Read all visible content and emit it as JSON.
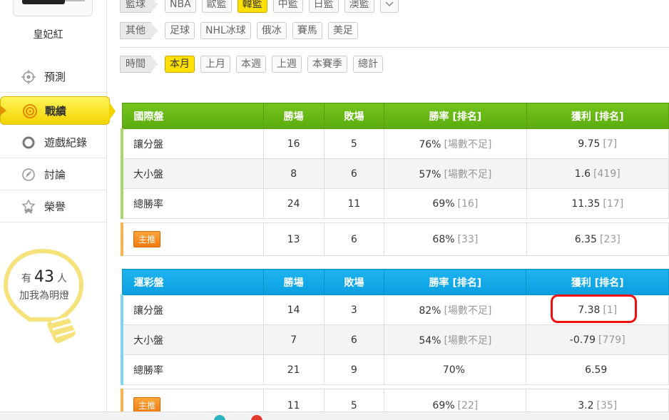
{
  "user": {
    "name": "皇妃紅"
  },
  "nav": [
    {
      "label": "預測",
      "icon": "target-icon"
    },
    {
      "label": "戰績",
      "icon": "swirl-icon",
      "active": true
    },
    {
      "label": "遊戲紀錄",
      "icon": "circle-icon"
    },
    {
      "label": "討論",
      "icon": "pencil-badge-icon"
    },
    {
      "label": "榮譽",
      "icon": "ribbon-icon"
    }
  ],
  "fans": {
    "prefix": "有",
    "count": "43",
    "suffix": "人",
    "subtitle": "加我為明燈"
  },
  "filters": {
    "basketball": {
      "label": "籃球",
      "options": [
        "NBA",
        "歐籃",
        "韓籃",
        "中籃",
        "日籃",
        "澳籃"
      ],
      "selected": "韓籃"
    },
    "others": {
      "label": "其他",
      "options": [
        "足球",
        "NHL冰球",
        "俄冰",
        "賽馬",
        "美足"
      ]
    },
    "time": {
      "label": "時間",
      "options": [
        "本月",
        "上月",
        "本週",
        "上週",
        "本賽季",
        "總計"
      ],
      "selected": "本月"
    }
  },
  "international": {
    "headers": [
      "國際盤",
      "勝場",
      "敗場",
      "勝率 [排名]",
      "獲利 [排名]"
    ],
    "rows": [
      {
        "name": "讓分盤",
        "win": "16",
        "loss": "5",
        "rate": "76%",
        "rate_rank": "[場數不足]",
        "profit": "9.75",
        "profit_rank": "[7]"
      },
      {
        "name": "大小盤",
        "win": "8",
        "loss": "6",
        "rate": "57%",
        "rate_rank": "[場數不足]",
        "profit": "1.6",
        "profit_rank": "[419]"
      },
      {
        "name": "總勝率",
        "win": "24",
        "loss": "11",
        "rate": "69%",
        "rate_rank": "[16]",
        "profit": "11.35",
        "profit_rank": "[17]"
      }
    ],
    "featured": {
      "badge": "主推",
      "win": "13",
      "loss": "6",
      "rate": "68%",
      "rate_rank": "[33]",
      "profit": "6.35",
      "profit_rank": "[23]"
    }
  },
  "lottery": {
    "headers": [
      "運彩盤",
      "勝場",
      "敗場",
      "勝率 [排名]",
      "獲利 [排名]"
    ],
    "rows": [
      {
        "name": "讓分盤",
        "win": "14",
        "loss": "3",
        "rate": "82%",
        "rate_rank": "[場數不足]",
        "profit": "7.38",
        "profit_rank": "[1]"
      },
      {
        "name": "大小盤",
        "win": "7",
        "loss": "6",
        "rate": "54%",
        "rate_rank": "[場數不足]",
        "profit": "-0.79",
        "profit_rank": "[779]"
      },
      {
        "name": "總勝率",
        "win": "21",
        "loss": "9",
        "rate": "70%",
        "rate_rank": "",
        "profit": "6.59",
        "profit_rank": ""
      }
    ],
    "featured": {
      "badge": "主推",
      "win": "11",
      "loss": "5",
      "rate": "69%",
      "rate_rank": "[22]",
      "profit": "3.2",
      "profit_rank": "[35]"
    }
  },
  "colors": {
    "green_header": "#66b814",
    "blue_header": "#13a8e8",
    "accent_yellow": "#ffe000",
    "highlight_red": "#e11111"
  }
}
